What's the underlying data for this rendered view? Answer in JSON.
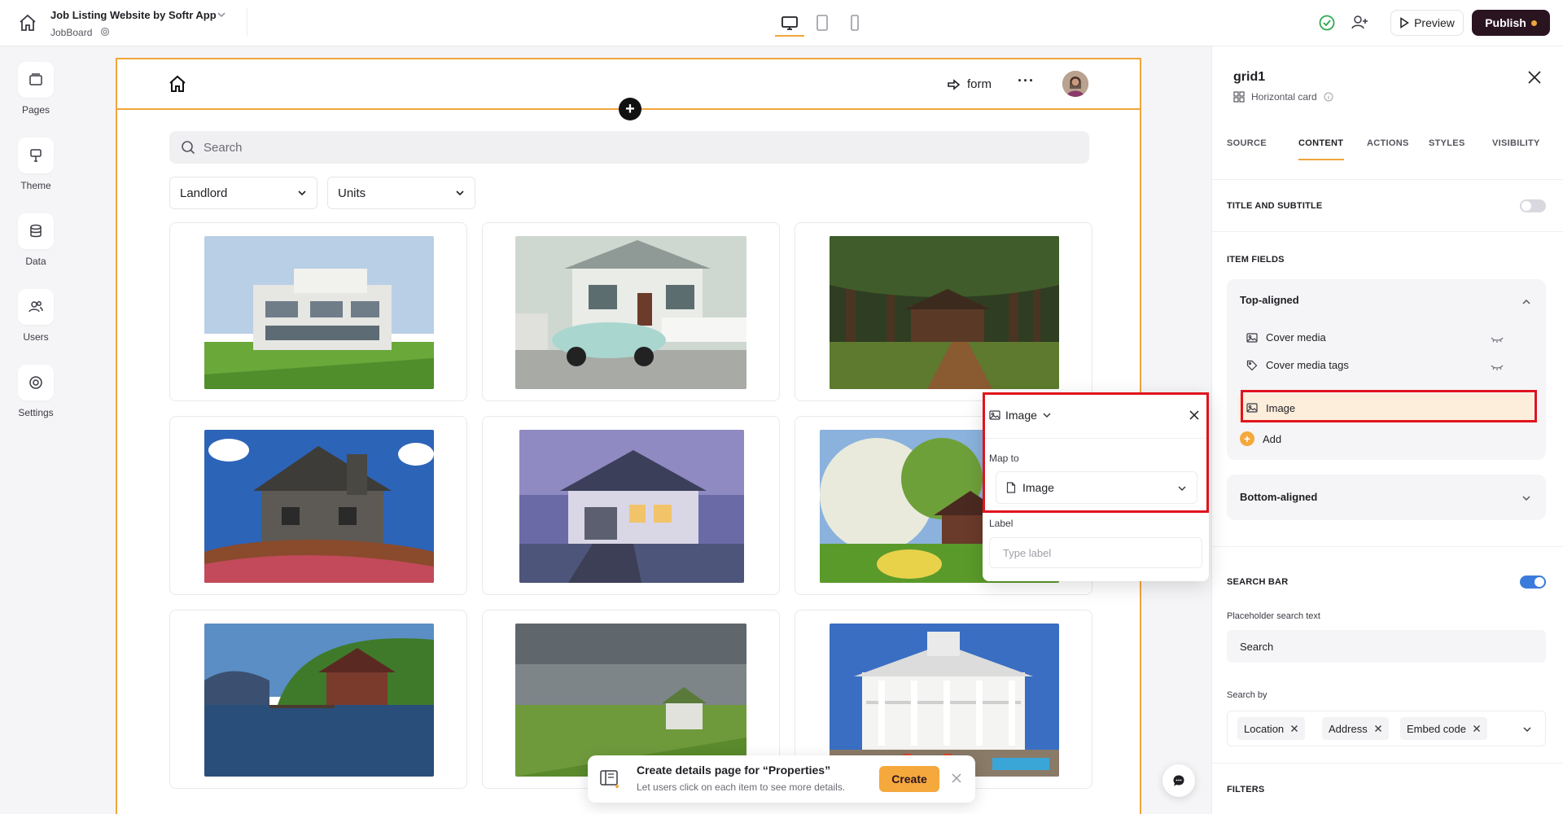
{
  "topbar": {
    "app_title": "Job Listing Website by Softr App",
    "app_subtitle": "JobBoard",
    "preview_label": "Preview",
    "publish_label": "Publish"
  },
  "rail": [
    {
      "label": "Pages",
      "icon": "pages-icon"
    },
    {
      "label": "Theme",
      "icon": "theme-icon"
    },
    {
      "label": "Data",
      "icon": "data-icon"
    },
    {
      "label": "Users",
      "icon": "users-icon"
    },
    {
      "label": "Settings",
      "icon": "settings-icon"
    }
  ],
  "canvas": {
    "header_link": "form",
    "search_placeholder": "Search",
    "filters": [
      "Landlord",
      "Units"
    ]
  },
  "popover": {
    "title": "Image",
    "map_to_label": "Map to",
    "map_to_value": "Image",
    "label_label": "Label",
    "label_placeholder": "Type label"
  },
  "toast": {
    "title": "Create details page for “Properties”",
    "subtitle": "Let users click on each item to see more details.",
    "create_label": "Create"
  },
  "panel": {
    "title": "grid1",
    "subtitle": "Horizontal card",
    "tabs": [
      "SOURCE",
      "CONTENT",
      "ACTIONS",
      "STYLES",
      "VISIBILITY"
    ],
    "active_tab": "CONTENT",
    "title_and_subtitle_label": "TITLE AND SUBTITLE",
    "title_and_subtitle_on": false,
    "item_fields_label": "ITEM FIELDS",
    "top_aligned": {
      "label": "Top-aligned",
      "fields": [
        "Cover media",
        "Cover media tags",
        "Image"
      ],
      "add_label": "Add"
    },
    "bottom_aligned_label": "Bottom-aligned",
    "search_bar_label": "SEARCH BAR",
    "search_bar_on": true,
    "placeholder_label": "Placeholder search text",
    "placeholder_value": "Search",
    "search_by_label": "Search by",
    "search_by_chips": [
      "Location",
      "Address",
      "Embed code"
    ],
    "filters_label": "FILTERS"
  },
  "colors": {
    "accent": "#f0a53c",
    "publish_bg": "#2a1420",
    "highlight_red": "#e0141e",
    "toggle_on": "#3b7bdc"
  }
}
